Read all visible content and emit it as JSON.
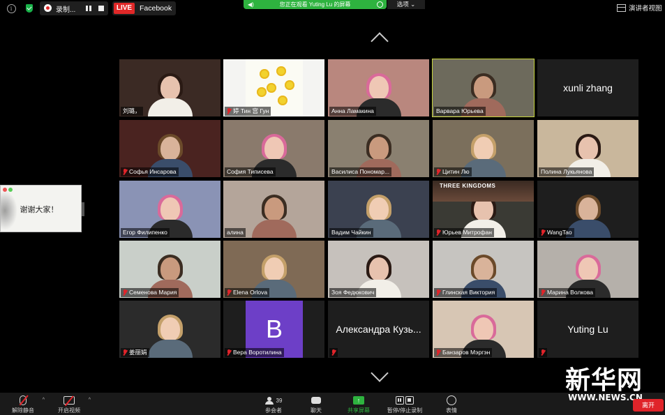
{
  "top_bar": {
    "recording_label": "录制...",
    "live_badge": "LIVE",
    "live_platform": "Facebook",
    "share_banner": "您正在观看 Yuting Lu 的屏幕",
    "options_label": "选项",
    "speaker_view_label": "演讲者视图"
  },
  "floating_share": {
    "text": "谢谢大家！"
  },
  "grid": {
    "active_tile": "Варвара Юрьева",
    "tiles": [
      {
        "name": "刘璐，",
        "muted": false,
        "video": true
      },
      {
        "name": "婷 Тин 宫 Гун",
        "muted": true,
        "video": true
      },
      {
        "name": "Анна Ламакина",
        "muted": false,
        "video": true
      },
      {
        "name": "Варвара Юрьева",
        "muted": false,
        "video": true
      },
      {
        "name": "xunli zhang",
        "muted": false,
        "video": false
      },
      {
        "name": "Софья Инсарова",
        "muted": true,
        "video": true
      },
      {
        "name": "София Типисева",
        "muted": false,
        "video": true
      },
      {
        "name": "Василиса Пономар...",
        "muted": false,
        "video": true
      },
      {
        "name": "Цитин Лю",
        "muted": true,
        "video": true
      },
      {
        "name": "Полина Лукьянова",
        "muted": false,
        "video": true
      },
      {
        "name": "Егор Филипенко",
        "muted": false,
        "video": true
      },
      {
        "name": "алина",
        "muted": false,
        "video": true
      },
      {
        "name": "Вадим Чайкин",
        "muted": false,
        "video": true
      },
      {
        "name": "Юрьев Митрофан",
        "muted": true,
        "video": true,
        "overlay": "THREE KINGDOMS"
      },
      {
        "name": "WangTao",
        "muted": true,
        "video": true
      },
      {
        "name": "Семенова Мария",
        "muted": true,
        "video": true
      },
      {
        "name": "Elena Orlova",
        "muted": true,
        "video": true
      },
      {
        "name": "Зоя Федюкович",
        "muted": false,
        "video": true
      },
      {
        "name": "Глинская Виктория",
        "muted": true,
        "video": true
      },
      {
        "name": "Марина Волкова",
        "muted": true,
        "video": true
      },
      {
        "name": "姜丽娟",
        "muted": true,
        "video": true
      },
      {
        "name": "Вера Воротилина",
        "muted": true,
        "video": false,
        "avatar_letter": "B"
      },
      {
        "name": "Александра Кузь...",
        "muted": true,
        "video": false
      },
      {
        "name": "Банзаров Мэргэн",
        "muted": true,
        "video": true
      },
      {
        "name": "Yuting Lu",
        "muted": true,
        "video": false
      }
    ]
  },
  "toolbar": {
    "unmute_label": "解除静音",
    "start_video_label": "开启视频",
    "participants_label": "参会者",
    "participants_count": "39",
    "chat_label": "聊天",
    "share_screen_label": "共享屏幕",
    "pause_stop_rec_label": "暂停/停止录制",
    "reactions_label": "表情",
    "leave_label": "离开"
  },
  "watermark": {
    "logo_text": "新华网",
    "url": "WWW.NEWS.CN"
  },
  "colors": {
    "live": "#e02828",
    "share_green": "#2eb33f",
    "active_border": "#c8d63e",
    "muted_red": "#e0242a"
  }
}
